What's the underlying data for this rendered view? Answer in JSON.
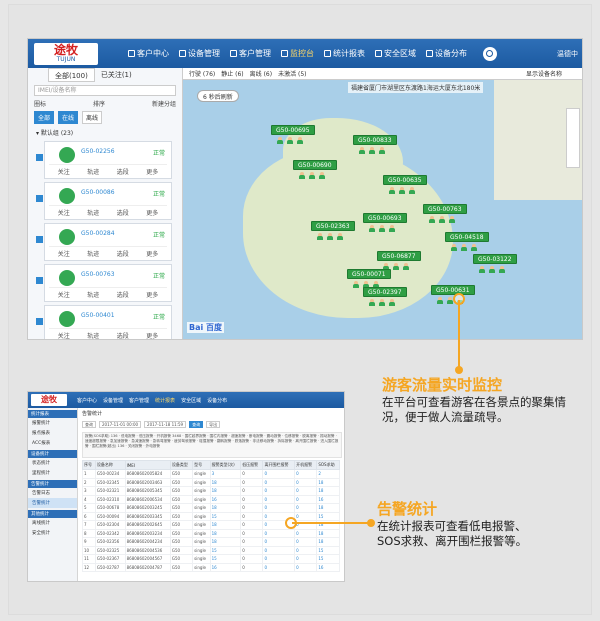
{
  "colors": {
    "accent": "#f5a623",
    "header_blue": "#1c5aa1",
    "marker_green": "#2f9e44"
  },
  "app": {
    "logo_cn": "途牧",
    "logo_en": "TUJUN",
    "nav": [
      "客户中心",
      "设备管理",
      "客户管理",
      "监控台",
      "统计报表",
      "安全区域",
      "设备分布"
    ],
    "active_nav_index": 3,
    "user_label": "温德中"
  },
  "sidebar": {
    "tab_all": "全部(100)",
    "tab_expired": "已关注(1)",
    "imei_placeholder": "IMEI/设备名称",
    "sort_label": "排序",
    "new_group": "新建分组",
    "tree_label": "圈标",
    "filters": [
      {
        "label": "全部",
        "on": true
      },
      {
        "label": "在线",
        "on": true
      },
      {
        "label": "离线",
        "on": false
      }
    ],
    "group_label": "默认组 (23)",
    "cards": [
      {
        "id": "G50-02256",
        "status": "正常"
      },
      {
        "id": "G50-00086",
        "status": "正常"
      },
      {
        "id": "G50-00284",
        "status": "正常"
      },
      {
        "id": "G50-00763",
        "status": "正常"
      },
      {
        "id": "G50-00401",
        "status": "正常"
      }
    ],
    "card_actions": [
      "关注",
      "轨迹",
      "选段",
      "更多"
    ]
  },
  "map": {
    "toolbar": [
      "行驶 (76)",
      "静止 (6)",
      "离线 (6)",
      "未激活 (5)"
    ],
    "show_name": "显示设备名称",
    "address": "福建省厦门市湖里区东渡路1海运大厦东北180米",
    "refresh": "6 秒后刷新",
    "markers": [
      "G50-00695",
      "G50-00833",
      "G50-00690",
      "G50-00635",
      "G50-00763",
      "G50-00693",
      "G50-02363",
      "G50-04518",
      "G50-06877",
      "G50-03122",
      "G50-00071",
      "G50-02397",
      "G50-00631"
    ],
    "provider": "Bai 百度"
  },
  "report": {
    "logo": "途牧",
    "nav": [
      "客户中心",
      "设备管理",
      "客户管理",
      "统计报表",
      "安全区域",
      "设备分布"
    ],
    "active_nav_index": 3,
    "side_sections": [
      {
        "head": "统计报表",
        "items": [
          "报警统计",
          "报点报表",
          "ACC报表"
        ]
      },
      {
        "head": "设备统计",
        "items": [
          "状态统计",
          "里程统计"
        ]
      },
      {
        "head": "告警统计",
        "items": [
          "告警日志",
          "告警统计"
        ]
      },
      {
        "head": "其他统计",
        "items": [
          "离线统计",
          "安全统计"
        ]
      }
    ],
    "selected_item": "告警统计",
    "title": "告警统计",
    "filter_btns": [
      "查询",
      "2017-11-01 00:00",
      "2017-11-18 11:59",
      "查询",
      "导出"
    ],
    "note": "报警(SOS求助) 136 · 低电报警 · 低压报警 · 开机报警 3468 · 围栏越界报警 · 围栏内报警 · 超速报警 · 断电报警 · 震动报警 · 位移报警 · 脱离报警 · 振动报警 · 速度超限报警 · 急加速报警 · 急减速报警 · 急转弯报警 · 疲劳驾驶报警 · 碰撞报警 · 翻转报警 · 跌落报警 · 非法移动报警 · 拆除报警 · 离开围栏报警 · 进入围栏报警 · 围栏报警(超出) 136 · 关闭报警 · 外电报警",
    "columns": [
      "序号",
      "设备名称",
      "IMEI",
      "设备类型",
      "型号",
      "报警类型(次)",
      "低压报警",
      "离开围栏报警",
      "开机报警",
      "SOS求助"
    ],
    "rows": [
      [
        "1",
        "G50-00234",
        "86808602005824",
        "G50",
        "single",
        "3",
        "0",
        "0",
        "0",
        "2"
      ],
      [
        "2",
        "G50-02345",
        "86808602003463",
        "G50",
        "single",
        "18",
        "0",
        "0",
        "0",
        "18"
      ],
      [
        "3",
        "G50-02321",
        "86808602005345",
        "G50",
        "single",
        "18",
        "0",
        "0",
        "0",
        "18"
      ],
      [
        "4",
        "G50-02310",
        "86808602006534",
        "G50",
        "single",
        "16",
        "0",
        "0",
        "0",
        "16"
      ],
      [
        "5",
        "G50-00678",
        "86808602003245",
        "G50",
        "single",
        "18",
        "0",
        "0",
        "0",
        "18"
      ],
      [
        "6",
        "G50-00094",
        "86808602003345",
        "G50",
        "single",
        "15",
        "0",
        "0",
        "0",
        "15"
      ],
      [
        "7",
        "G50-02304",
        "86808602002645",
        "G50",
        "single",
        "18",
        "0",
        "0",
        "0",
        "18"
      ],
      [
        "8",
        "G50-02342",
        "86808602003234",
        "G50",
        "single",
        "18",
        "0",
        "0",
        "0",
        "18"
      ],
      [
        "9",
        "G50-02356",
        "86808602004234",
        "G50",
        "single",
        "18",
        "0",
        "0",
        "0",
        "18"
      ],
      [
        "10",
        "G50-02325",
        "86808602004536",
        "G50",
        "single",
        "15",
        "0",
        "0",
        "0",
        "15"
      ],
      [
        "11",
        "G50-02367",
        "86808602004567",
        "G50",
        "single",
        "15",
        "0",
        "0",
        "0",
        "15"
      ],
      [
        "12",
        "G50-02787",
        "86808602004787",
        "G50",
        "single",
        "16",
        "0",
        "0",
        "0",
        "16"
      ]
    ]
  },
  "callout1": {
    "title": "游客流量实时监控",
    "desc": "在平台可查看游客在各景点的聚集情况，便于做人流量疏导。"
  },
  "callout2": {
    "title": "告警统计",
    "desc": "在统计报表可查看低电报警、SOS求救、离开围栏报警等。"
  }
}
